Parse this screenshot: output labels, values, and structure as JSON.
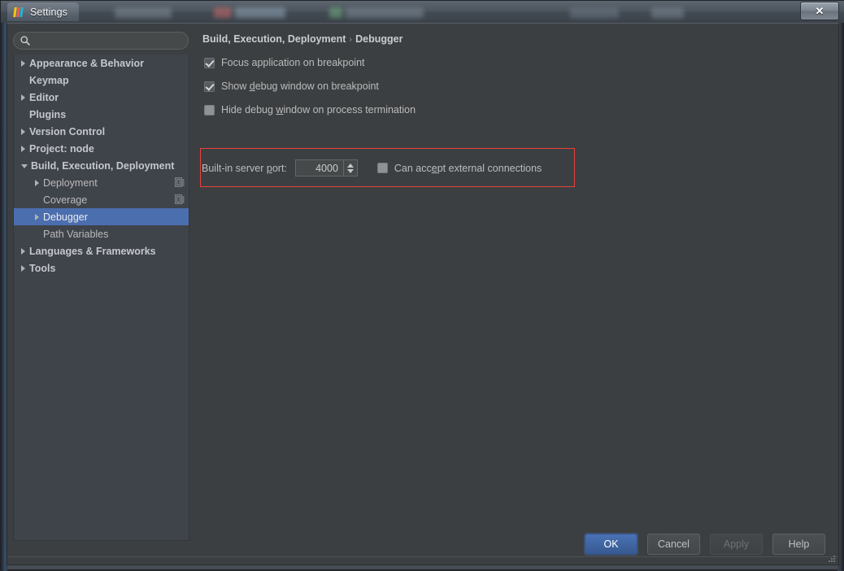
{
  "window": {
    "title": "Settings",
    "app_icon": "intellij-idea-icon",
    "close_label": "✕"
  },
  "search": {
    "placeholder": "",
    "value": "",
    "icon": "search-icon"
  },
  "sidebar": {
    "items": [
      {
        "label": "Appearance & Behavior",
        "level": 0,
        "twisty": "closed",
        "top": true,
        "selected": false,
        "scope_icon": false
      },
      {
        "label": "Keymap",
        "level": 0,
        "twisty": "none",
        "top": true,
        "selected": false,
        "scope_icon": false
      },
      {
        "label": "Editor",
        "level": 0,
        "twisty": "closed",
        "top": true,
        "selected": false,
        "scope_icon": false
      },
      {
        "label": "Plugins",
        "level": 0,
        "twisty": "none",
        "top": true,
        "selected": false,
        "scope_icon": false
      },
      {
        "label": "Version Control",
        "level": 0,
        "twisty": "closed",
        "top": true,
        "selected": false,
        "scope_icon": false
      },
      {
        "label": "Project: node",
        "level": 0,
        "twisty": "closed",
        "top": true,
        "selected": false,
        "scope_icon": false
      },
      {
        "label": "Build, Execution, Deployment",
        "level": 0,
        "twisty": "open",
        "top": true,
        "selected": false,
        "scope_icon": false
      },
      {
        "label": "Deployment",
        "level": 1,
        "twisty": "closed",
        "top": false,
        "selected": false,
        "scope_icon": true
      },
      {
        "label": "Coverage",
        "level": 1,
        "twisty": "none",
        "top": false,
        "selected": false,
        "scope_icon": true
      },
      {
        "label": "Debugger",
        "level": 1,
        "twisty": "closed",
        "top": false,
        "selected": true,
        "scope_icon": false
      },
      {
        "label": "Path Variables",
        "level": 1,
        "twisty": "none",
        "top": false,
        "selected": false,
        "scope_icon": false
      },
      {
        "label": "Languages & Frameworks",
        "level": 0,
        "twisty": "closed",
        "top": true,
        "selected": false,
        "scope_icon": false
      },
      {
        "label": "Tools",
        "level": 0,
        "twisty": "closed",
        "top": true,
        "selected": false,
        "scope_icon": false
      }
    ]
  },
  "content": {
    "breadcrumb": {
      "parent": "Build, Execution, Deployment",
      "separator": "›",
      "current": "Debugger"
    },
    "options": [
      {
        "label": "Focus application on breakpoint",
        "checked": true,
        "style": "check",
        "mnemonic": ""
      },
      {
        "label": "Show debug window on breakpoint",
        "checked": true,
        "style": "check",
        "mnemonic": "d"
      },
      {
        "label": "Hide debug window on process termination",
        "checked": false,
        "style": "flat",
        "mnemonic": "w"
      }
    ],
    "port": {
      "label": "Built-in server port:",
      "label_mnemonic": "p",
      "value": "4000",
      "spinner_up": "increment-arrow",
      "spinner_down": "decrement-arrow"
    },
    "external_connections": {
      "label": "Can accept external connections",
      "mnemonic": "e",
      "checked": false
    },
    "annotation_color": "#e8413c"
  },
  "footer": {
    "buttons": [
      {
        "label": "OK",
        "kind": "default"
      },
      {
        "label": "Cancel",
        "kind": "normal"
      },
      {
        "label": "Apply",
        "kind": "disabled"
      },
      {
        "label": "Help",
        "kind": "normal"
      }
    ]
  },
  "theme": {
    "content_bg": "#3c3f41",
    "sidebar_bg": "#3f434a",
    "selection_bg": "#4b6eaf",
    "text": "#bbbbbb",
    "default_button": "#4a72b5"
  }
}
